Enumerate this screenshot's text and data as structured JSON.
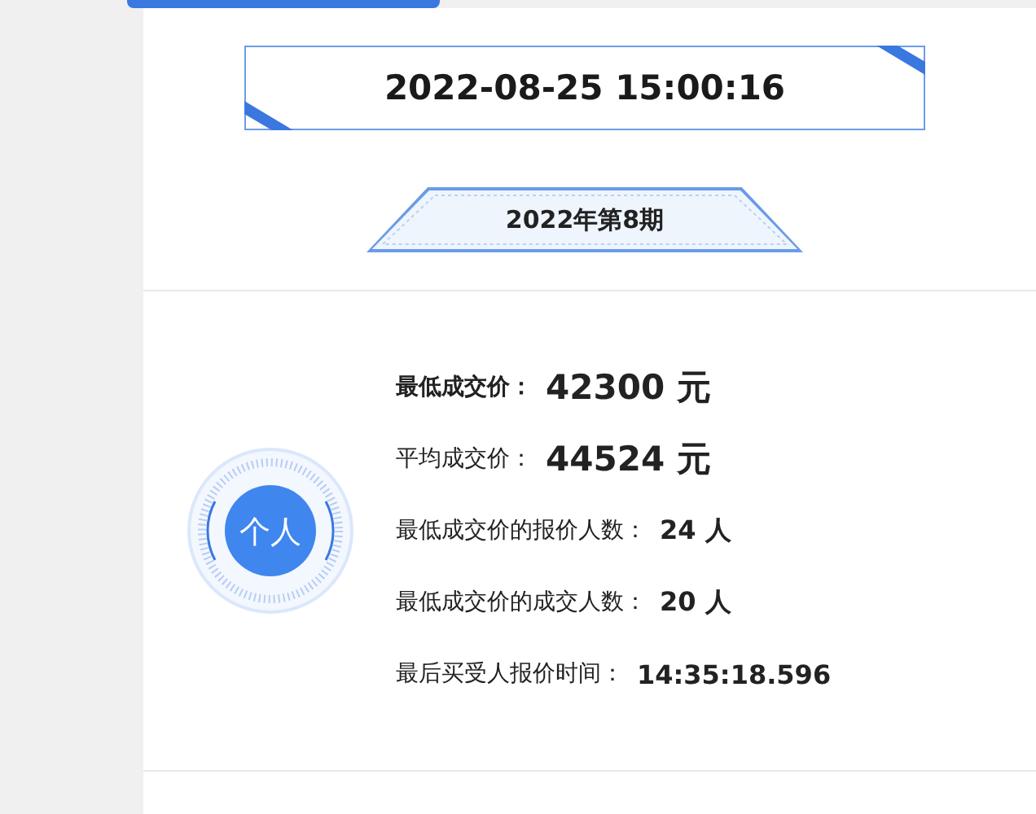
{
  "datetime": "2022-08-25 15:00:16",
  "period": "2022年第8期",
  "badge": "个人",
  "stats": [
    {
      "label": "最低成交价：",
      "value": "42300 元",
      "kind": "price",
      "strong": true
    },
    {
      "label": "平均成交价：",
      "value": "44524 元",
      "kind": "price",
      "strong": false
    },
    {
      "label": "最低成交价的报价人数：",
      "value": "24 人",
      "kind": "count",
      "strong": false
    },
    {
      "label": "最低成交价的成交人数：",
      "value": "20 人",
      "kind": "count",
      "strong": false
    },
    {
      "label": "最后买受人报价时间：",
      "value": "14:35:18.596",
      "kind": "count",
      "strong": false
    }
  ]
}
